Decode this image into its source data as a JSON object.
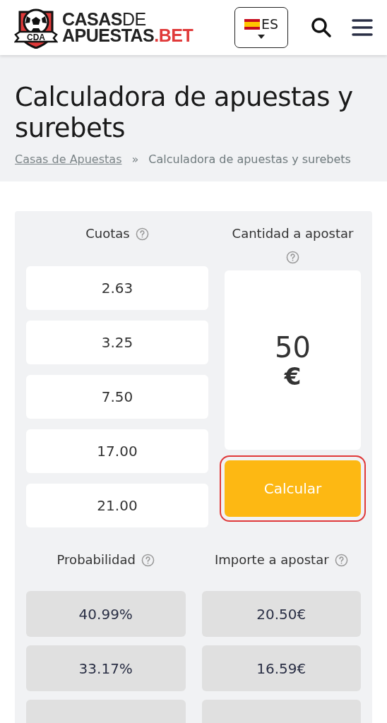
{
  "header": {
    "logo": {
      "badge": "CDA",
      "line1_bold": "CASAS",
      "line1_light": "DE",
      "line2_bold": "APUESTAS",
      "line2_accent": ".BET"
    },
    "language": "ES"
  },
  "title": "Calculadora de apuestas y surebets",
  "breadcrumb": {
    "link": "Casas de Apuestas",
    "separator": "»",
    "current": "Calculadora de apuestas y surebets"
  },
  "calculator": {
    "odds_label": "Cuotas",
    "stake_label": "Cantidad a apostar",
    "odds": [
      "2.63",
      "3.25",
      "7.50",
      "17.00",
      "21.00"
    ],
    "stake": {
      "amount": "50",
      "currency": "€"
    },
    "button": {
      "label": "Calcular",
      "focused": true
    },
    "probability_label": "Probabilidad",
    "bet_label": "Importe a apostar",
    "results": [
      {
        "probability": "40.99%",
        "bet": "20.50€"
      },
      {
        "probability": "33.17%",
        "bet": "16.59€"
      }
    ]
  }
}
